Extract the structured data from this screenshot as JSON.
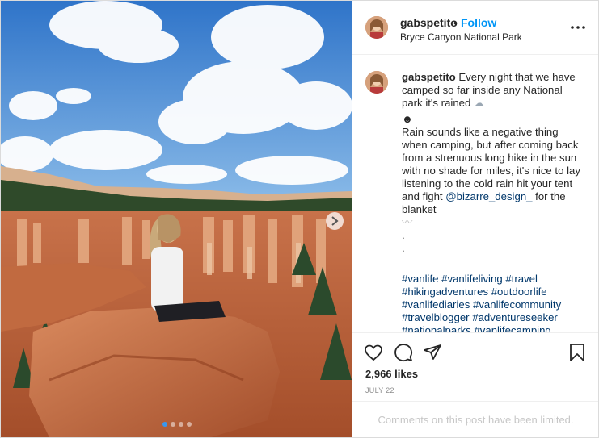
{
  "post": {
    "username": "gabspetito",
    "separator": "•",
    "follow_label": "Follow",
    "location": "Bryce Canyon National Park"
  },
  "caption": {
    "username": "gabspetito",
    "line1": "Every night that we have camped so far inside any National park it's rained",
    "line1_emoji": "☁",
    "line2": "☻",
    "line3": "Rain sounds like a negative thing when camping, but after coming back from a strenuous long hike in the sun with no shade for miles, it's nice to lay listening to the cold rain hit your tent and fight",
    "mention": "@bizarre_design_",
    "line3_end": "for the blanket",
    "line4": "〰",
    "dot1": ".",
    "dot2": ".",
    "hashtags": [
      "#vanlife",
      "#vanlifeliving",
      "#travel",
      "#hikingadventures",
      "#outdoorlife",
      "#vanlifediaries",
      "#vanlifecommunity",
      "#travelblogger",
      "#adventureseeker",
      "#nationalparks",
      "#vanlifecamping"
    ]
  },
  "stats": {
    "likes": "2,966 likes",
    "date": "JULY 22"
  },
  "comments_notice": "Comments on this post have been limited.",
  "carousel": {
    "total_slides": 4,
    "active_index": 0
  },
  "icons": {
    "more": "more-options-icon",
    "like": "heart-icon",
    "comment": "comment-icon",
    "share": "share-icon",
    "save": "bookmark-icon",
    "next": "chevron-right-icon"
  },
  "colors": {
    "follow": "#0095f6",
    "link": "#00376b",
    "muted": "#8e8e8e",
    "active_dot": "#3897f0"
  }
}
